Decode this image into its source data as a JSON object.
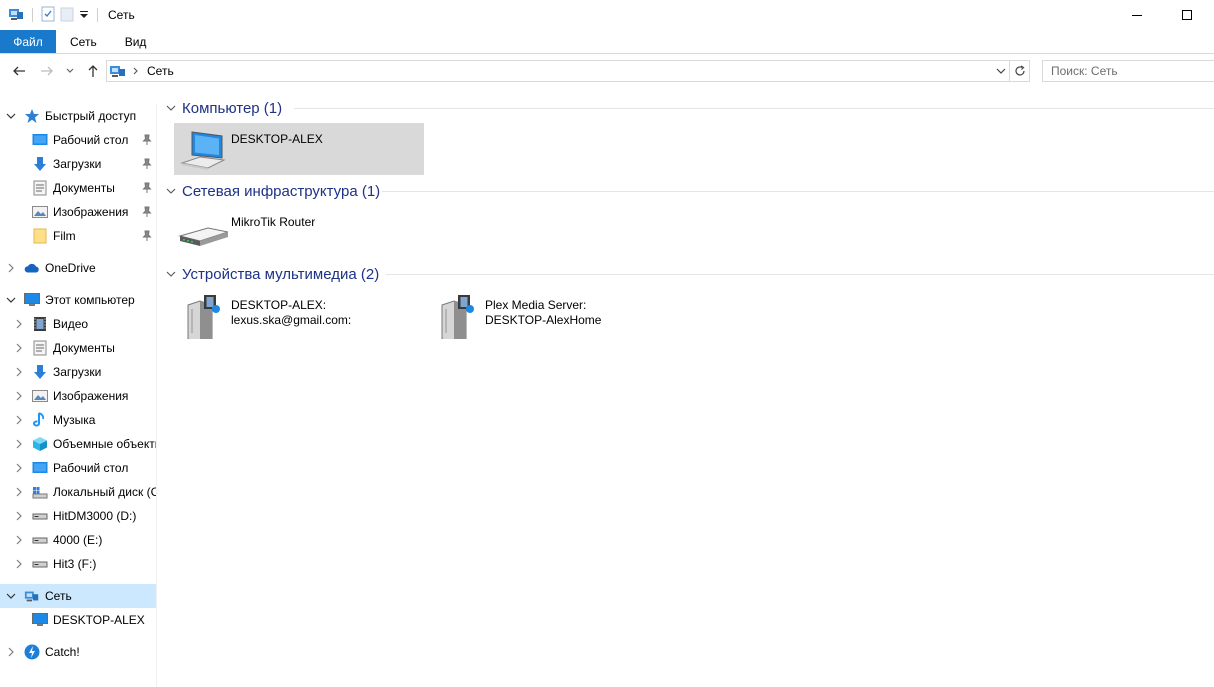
{
  "window": {
    "title": "Сеть",
    "minimize_glyph": "—",
    "maximize_glyph": "☐"
  },
  "ribbon": {
    "tabs": [
      "Файл",
      "Сеть",
      "Вид"
    ]
  },
  "address": {
    "crumb": "Сеть",
    "search_placeholder": "Поиск: Сеть"
  },
  "sidebar": {
    "items": [
      {
        "label": "Быстрый доступ",
        "icon": "star-icon"
      },
      {
        "label": "Рабочий стол",
        "icon": "desktop-icon"
      },
      {
        "label": "Загрузки",
        "icon": "download-icon"
      },
      {
        "label": "Документы",
        "icon": "documents-icon"
      },
      {
        "label": "Изображения",
        "icon": "pictures-icon"
      },
      {
        "label": "Film",
        "icon": "folder-icon"
      },
      {
        "label": "OneDrive",
        "icon": "cloud-icon"
      },
      {
        "label": "Этот компьютер",
        "icon": "computer-icon"
      },
      {
        "label": "Видео",
        "icon": "video-icon"
      },
      {
        "label": "Документы",
        "icon": "documents-icon"
      },
      {
        "label": "Загрузки",
        "icon": "download-icon"
      },
      {
        "label": "Изображения",
        "icon": "pictures-icon"
      },
      {
        "label": "Музыка",
        "icon": "music-icon"
      },
      {
        "label": "Объемные объекты",
        "icon": "3d-objects-icon"
      },
      {
        "label": "Рабочий стол",
        "icon": "desktop-icon"
      },
      {
        "label": "Локальный диск (C:)",
        "icon": "system-drive-icon"
      },
      {
        "label": "HitDM3000 (D:)",
        "icon": "drive-icon"
      },
      {
        "label": "4000 (E:)",
        "icon": "drive-icon"
      },
      {
        "label": "Hit3 (F:)",
        "icon": "drive-icon"
      },
      {
        "label": "Сеть",
        "icon": "network-icon"
      },
      {
        "label": "DESKTOP-ALEX",
        "icon": "computer-icon"
      },
      {
        "label": "Catch!",
        "icon": "catch-app-icon"
      }
    ]
  },
  "groups": [
    {
      "header": "Компьютер (1)",
      "items": [
        {
          "line1": "DESKTOP-ALEX",
          "line2": "",
          "icon": "computer-icon"
        }
      ]
    },
    {
      "header": "Сетевая инфраструктура (1)",
      "items": [
        {
          "line1": "MikroTik Router",
          "line2": "",
          "icon": "router-icon"
        }
      ]
    },
    {
      "header": "Устройства мультимедиа (2)",
      "items": [
        {
          "line1": "DESKTOP-ALEX:",
          "line2": "lexus.ska@gmail.com:",
          "icon": "media-server-icon"
        },
        {
          "line1": "Plex Media Server:",
          "line2": "DESKTOP-AlexHome",
          "icon": "media-server-icon"
        }
      ]
    }
  ],
  "colors": {
    "accent": "#1979ca",
    "group_header": "#1e3287",
    "selection": "#cce8ff",
    "tile_selected": "#d9d9d9"
  }
}
